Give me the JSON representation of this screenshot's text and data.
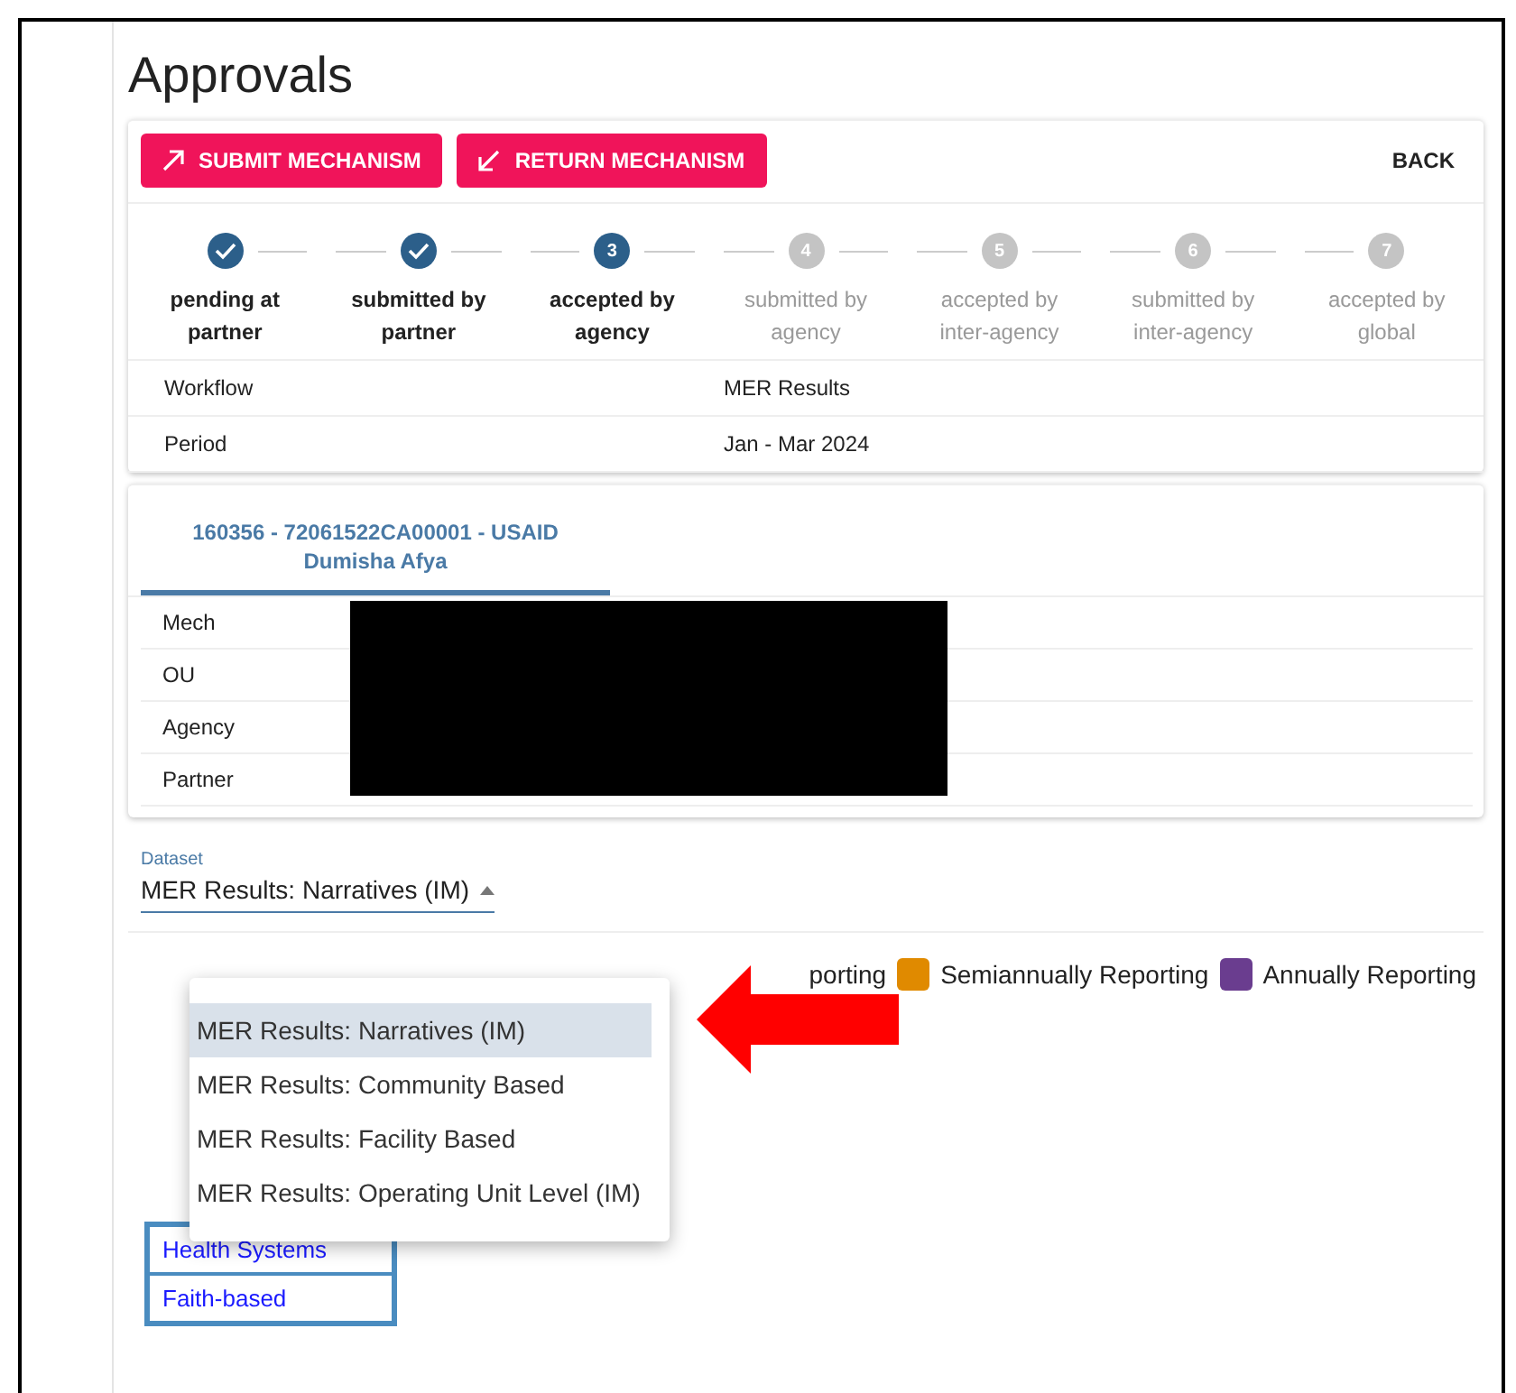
{
  "page": {
    "title": "Approvals"
  },
  "actions": [
    {
      "label": "SUBMIT MECHANISM",
      "kind": "submit"
    },
    {
      "label": "RETURN MECHANISM",
      "kind": "return"
    }
  ],
  "back": "BACK",
  "steps": [
    {
      "kind": "done",
      "label": "pending at partner"
    },
    {
      "kind": "done",
      "label": "submitted by partner"
    },
    {
      "kind": "current",
      "number": "3",
      "label": "accepted by agency"
    },
    {
      "kind": "pending",
      "number": "4",
      "label": "submitted by agency"
    },
    {
      "kind": "pending",
      "number": "5",
      "label": "accepted by inter-agency"
    },
    {
      "kind": "pending",
      "number": "6",
      "label": "submitted by inter-agency"
    },
    {
      "kind": "pending",
      "number": "7",
      "label": "accepted by global"
    }
  ],
  "info": [
    {
      "label": "Workflow",
      "value": "MER Results"
    },
    {
      "label": "Period",
      "value": "Jan - Mar 2024"
    }
  ],
  "mechanism_tab": {
    "title": "160356 - 72061522CA00001 - USAID Dumisha Afya",
    "selected": true
  },
  "mechanism_rows": [
    {
      "label": "Mech"
    },
    {
      "label": "OU"
    },
    {
      "label": "Agency"
    },
    {
      "label": "Partner"
    }
  ],
  "dataset": {
    "label": "Dataset",
    "value": "MER Results: Narratives (IM)",
    "expanded": true
  },
  "dataset_menu": [
    {
      "label": "MER Results: Narratives (IM)",
      "selected": true
    },
    {
      "label": "MER Results: Community Based",
      "selected": false
    },
    {
      "label": "MER Results: Facility Based",
      "selected": false
    },
    {
      "label": "MER Results: Operating Unit Level (IM)",
      "selected": false
    }
  ],
  "legend": [
    {
      "label": "porting"
    },
    {
      "label": "Semiannually Reporting",
      "color": "#e08a00"
    },
    {
      "label": "Annually Reporting",
      "color": "#6a3d8f"
    }
  ],
  "links": [
    "Health Systems",
    "Faith-based"
  ]
}
